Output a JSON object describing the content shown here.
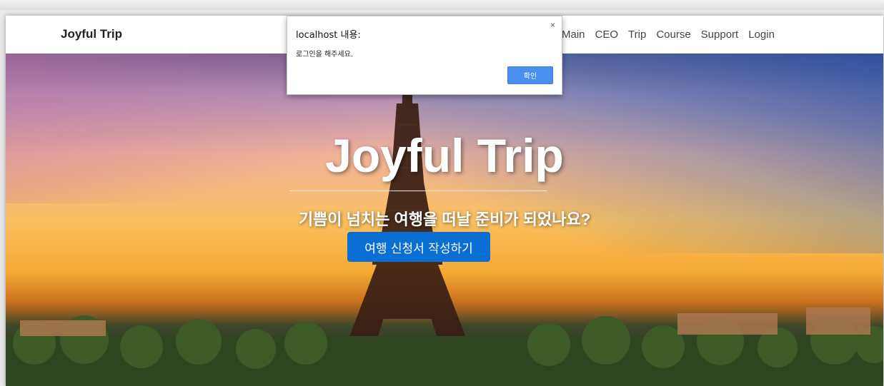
{
  "navbar": {
    "brand": "Joyful Trip",
    "links": [
      "Main",
      "CEO",
      "Trip",
      "Course",
      "Support",
      "Login"
    ]
  },
  "hero": {
    "title": "Joyful Trip",
    "subtitle": "기쁨이 넘치는 여행을 떠날 준비가 되었나요?",
    "cta_label": "여행 신청서 작성하기"
  },
  "dialog": {
    "title": "localhost 내용:",
    "message": "로그인을 해주세요.",
    "ok_label": "확인",
    "close_icon": "×"
  },
  "colors": {
    "cta": "#0a6fd4",
    "dialog_ok": "#4a8ef0"
  }
}
